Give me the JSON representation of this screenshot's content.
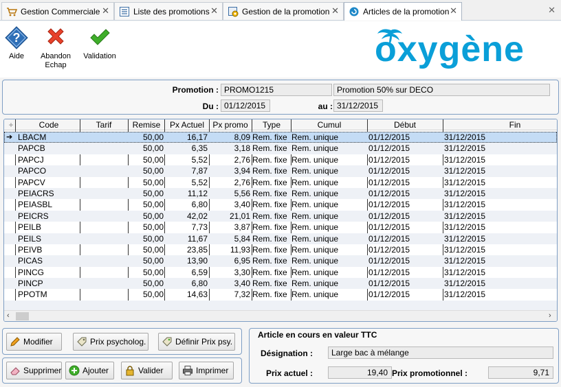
{
  "tabs": [
    {
      "label": "Gestion Commerciale",
      "icon": "cart-icon",
      "active": true
    },
    {
      "label": "Liste des promotions",
      "icon": "list-icon",
      "active": false
    },
    {
      "label": "Gestion de la promotion",
      "icon": "gear-icon",
      "active": false
    },
    {
      "label": "Articles de la promotion",
      "icon": "circle-icon",
      "active": true
    }
  ],
  "toolbar": {
    "help": "Aide",
    "cancel": "Abandon\nEchap",
    "cancel_line1": "Abandon",
    "cancel_line2": "Echap",
    "validate": "Validation"
  },
  "logo": {
    "text": "oxygène",
    "color": "#0a9fd8"
  },
  "promo": {
    "promotion_label": "Promotion :",
    "code": "PROMO1215",
    "description": "Promotion 50% sur DECO",
    "du_label": "Du :",
    "du": "01/12/2015",
    "au_label": "au :",
    "au": "31/12/2015"
  },
  "grid": {
    "columns": [
      "Code",
      "Tarif",
      "Remise",
      "Px Actuel",
      "Px promo",
      "Type",
      "Cumul",
      "Début",
      "Fin"
    ],
    "rows": [
      {
        "code": "LBACM",
        "tarif": "",
        "remise": "50,00",
        "px_actuel": "16,17",
        "px_promo": "8,09",
        "type": "Rem. fixe",
        "cumul": "Rem. unique",
        "debut": "01/12/2015",
        "fin": "31/12/2015"
      },
      {
        "code": "PAPCB",
        "tarif": "",
        "remise": "50,00",
        "px_actuel": "6,35",
        "px_promo": "3,18",
        "type": "Rem. fixe",
        "cumul": "Rem. unique",
        "debut": "01/12/2015",
        "fin": "31/12/2015"
      },
      {
        "code": "PAPCJ",
        "tarif": "",
        "remise": "50,00",
        "px_actuel": "5,52",
        "px_promo": "2,76",
        "type": "Rem. fixe",
        "cumul": "Rem. unique",
        "debut": "01/12/2015",
        "fin": "31/12/2015"
      },
      {
        "code": "PAPCO",
        "tarif": "",
        "remise": "50,00",
        "px_actuel": "7,87",
        "px_promo": "3,94",
        "type": "Rem. fixe",
        "cumul": "Rem. unique",
        "debut": "01/12/2015",
        "fin": "31/12/2015"
      },
      {
        "code": "PAPCV",
        "tarif": "",
        "remise": "50,00",
        "px_actuel": "5,52",
        "px_promo": "2,76",
        "type": "Rem. fixe",
        "cumul": "Rem. unique",
        "debut": "01/12/2015",
        "fin": "31/12/2015"
      },
      {
        "code": "PEIACRS",
        "tarif": "",
        "remise": "50,00",
        "px_actuel": "11,12",
        "px_promo": "5,56",
        "type": "Rem. fixe",
        "cumul": "Rem. unique",
        "debut": "01/12/2015",
        "fin": "31/12/2015"
      },
      {
        "code": "PEIASBL",
        "tarif": "",
        "remise": "50,00",
        "px_actuel": "6,80",
        "px_promo": "3,40",
        "type": "Rem. fixe",
        "cumul": "Rem. unique",
        "debut": "01/12/2015",
        "fin": "31/12/2015"
      },
      {
        "code": "PEICRS",
        "tarif": "",
        "remise": "50,00",
        "px_actuel": "42,02",
        "px_promo": "21,01",
        "type": "Rem. fixe",
        "cumul": "Rem. unique",
        "debut": "01/12/2015",
        "fin": "31/12/2015"
      },
      {
        "code": "PEILB",
        "tarif": "",
        "remise": "50,00",
        "px_actuel": "7,73",
        "px_promo": "3,87",
        "type": "Rem. fixe",
        "cumul": "Rem. unique",
        "debut": "01/12/2015",
        "fin": "31/12/2015"
      },
      {
        "code": "PEILS",
        "tarif": "",
        "remise": "50,00",
        "px_actuel": "11,67",
        "px_promo": "5,84",
        "type": "Rem. fixe",
        "cumul": "Rem. unique",
        "debut": "01/12/2015",
        "fin": "31/12/2015"
      },
      {
        "code": "PEIVB",
        "tarif": "",
        "remise": "50,00",
        "px_actuel": "23,85",
        "px_promo": "11,93",
        "type": "Rem. fixe",
        "cumul": "Rem. unique",
        "debut": "01/12/2015",
        "fin": "31/12/2015"
      },
      {
        "code": "PICAS",
        "tarif": "",
        "remise": "50,00",
        "px_actuel": "13,90",
        "px_promo": "6,95",
        "type": "Rem. fixe",
        "cumul": "Rem. unique",
        "debut": "01/12/2015",
        "fin": "31/12/2015"
      },
      {
        "code": "PINCG",
        "tarif": "",
        "remise": "50,00",
        "px_actuel": "6,59",
        "px_promo": "3,30",
        "type": "Rem. fixe",
        "cumul": "Rem. unique",
        "debut": "01/12/2015",
        "fin": "31/12/2015"
      },
      {
        "code": "PINCP",
        "tarif": "",
        "remise": "50,00",
        "px_actuel": "6,80",
        "px_promo": "3,40",
        "type": "Rem. fixe",
        "cumul": "Rem. unique",
        "debut": "01/12/2015",
        "fin": "31/12/2015"
      },
      {
        "code": "PPOTM",
        "tarif": "",
        "remise": "50,00",
        "px_actuel": "14,63",
        "px_promo": "7,32",
        "type": "Rem. fixe",
        "cumul": "Rem. unique",
        "debut": "01/12/2015",
        "fin": "31/12/2015"
      }
    ]
  },
  "actions": {
    "modify": "Modifier",
    "price_psycho": "Prix psycholog.",
    "define_price": "Définir Prix psy.",
    "delete": "Supprimer",
    "add": "Ajouter",
    "validate": "Valider",
    "print": "Imprimer"
  },
  "article": {
    "title": "Article en cours en valeur TTC",
    "designation_label": "Désignation :",
    "designation": "Large bac à mélange",
    "prix_actuel_label": "Prix actuel :",
    "prix_actuel": "19,40",
    "prix_promo_label": "Prix promotionnel :",
    "prix_promo": "9,71"
  }
}
